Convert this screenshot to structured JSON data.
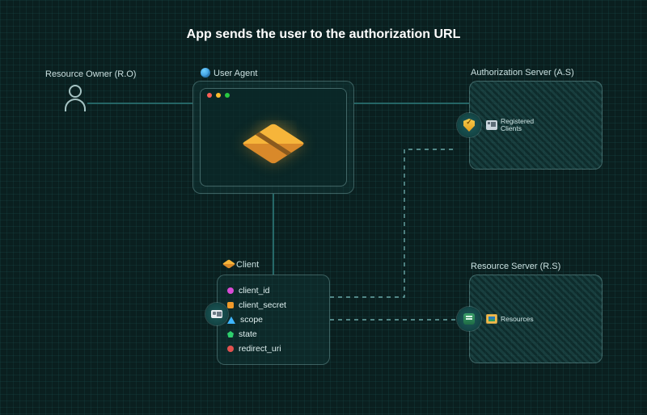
{
  "title": "App sends the user to the authorization URL",
  "resource_owner": {
    "label": "Resource Owner (R.O)"
  },
  "user_agent": {
    "label": "User Agent"
  },
  "client": {
    "label": "Client",
    "side_icon": "id-card-icon",
    "params": [
      {
        "key": "client_id",
        "shape": "circle",
        "color": "#d94bd6"
      },
      {
        "key": "client_secret",
        "shape": "square",
        "color": "#f09a2a"
      },
      {
        "key": "scope",
        "shape": "triangle",
        "color": "#3fb6ff"
      },
      {
        "key": "state",
        "shape": "pentagon",
        "color": "#2ecf6d"
      },
      {
        "key": "redirect_uri",
        "shape": "circle",
        "color": "#e2524f"
      }
    ]
  },
  "auth_server": {
    "label": "Authorization Server (A.S)",
    "badge_icon": "shield-icon",
    "badge_text": "Registered Clients"
  },
  "resource_server": {
    "label": "Resource Server (R.S)",
    "badge_icon": "database-icon",
    "badge_text": "Resources"
  },
  "connections": [
    {
      "from": "resource_owner",
      "to": "user_agent",
      "style": "solid"
    },
    {
      "from": "user_agent",
      "to": "auth_server",
      "style": "solid"
    },
    {
      "from": "user_agent",
      "to": "client",
      "style": "solid"
    },
    {
      "from": "client",
      "to": "auth_server",
      "style": "dashed"
    },
    {
      "from": "client",
      "to": "resource_server",
      "style": "dashed"
    }
  ],
  "colors": {
    "bg": "#0a1f1f",
    "panel_border": "rgba(150,200,200,0.35)",
    "line": "#2a6b6b",
    "accent_package": "#f6b53a"
  }
}
